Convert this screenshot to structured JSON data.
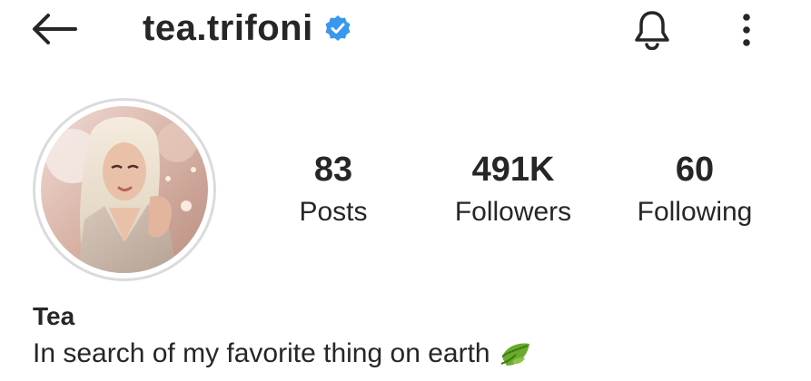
{
  "header": {
    "username": "tea.trifoni",
    "verified": true,
    "icons": {
      "back": "arrow-left-icon",
      "verified": "verified-badge-icon",
      "notifications": "bell-icon",
      "more": "more-vertical-icon"
    }
  },
  "profile": {
    "avatar": "profile-photo",
    "stats": [
      {
        "value": "83",
        "label": "Posts"
      },
      {
        "value": "491K",
        "label": "Followers"
      },
      {
        "value": "60",
        "label": "Following"
      }
    ],
    "name": "Tea",
    "bio": "In search of my favorite thing on earth",
    "bio_emoji": "leaf-icon"
  },
  "colors": {
    "text": "#262626",
    "verified": "#3897f0",
    "avatar_ring": "#dbdbdb"
  }
}
